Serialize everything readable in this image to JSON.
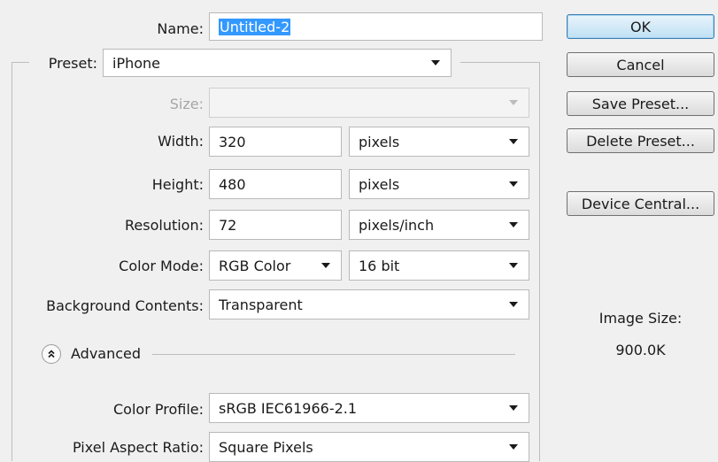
{
  "fields": {
    "name_label": "Name:",
    "name_value": "Untitled-2",
    "preset_label": "Preset:",
    "preset_value": "iPhone",
    "size_label": "Size:",
    "size_value": "",
    "width_label": "Width:",
    "width_value": "320",
    "width_unit": "pixels",
    "height_label": "Height:",
    "height_value": "480",
    "height_unit": "pixels",
    "resolution_label": "Resolution:",
    "resolution_value": "72",
    "resolution_unit": "pixels/inch",
    "color_mode_label": "Color Mode:",
    "color_mode_value": "RGB Color",
    "bit_depth_value": "16 bit",
    "background_label": "Background Contents:",
    "background_value": "Transparent",
    "advanced_label": "Advanced",
    "color_profile_label": "Color Profile:",
    "color_profile_value": "sRGB IEC61966-2.1",
    "pixel_aspect_label": "Pixel Aspect Ratio:",
    "pixel_aspect_value": "Square Pixels"
  },
  "buttons": {
    "ok": "OK",
    "cancel": "Cancel",
    "save_preset": "Save Preset...",
    "delete_preset": "Delete Preset...",
    "device_central": "Device Central..."
  },
  "image_size": {
    "label": "Image Size:",
    "value": "900.0K"
  },
  "icons": {
    "dropdown": "chevron-down-icon",
    "advanced_toggle": "collapse-icon"
  },
  "colors": {
    "dialog_background": "#f0f0f0",
    "selection": "#3399ff",
    "default_button": "#bfe0f4"
  }
}
